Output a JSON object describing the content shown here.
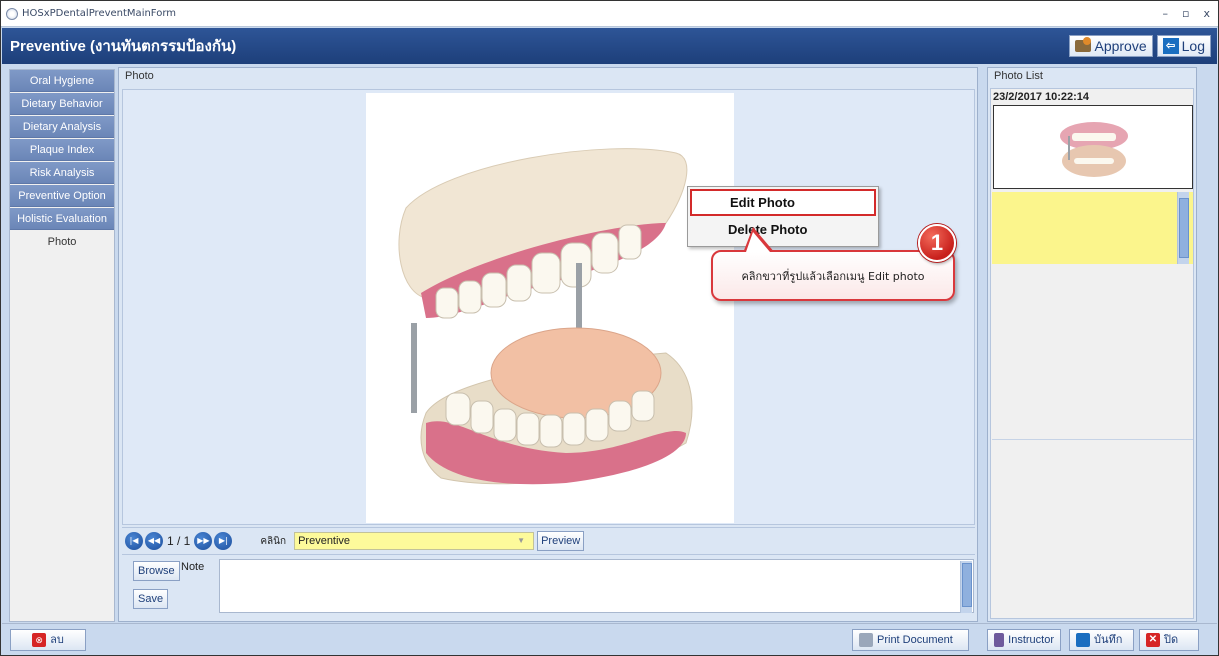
{
  "window": {
    "title": "HOSxPDentalPreventMainForm",
    "controls": [
      "–",
      "▫",
      "x"
    ]
  },
  "header": {
    "title": "Preventive (งานทันตกรรมป้องกัน)",
    "approve_label": "Approve",
    "log_label": "Log"
  },
  "sidebar": {
    "items": [
      {
        "label": "Oral Hygiene"
      },
      {
        "label": "Dietary Behavior"
      },
      {
        "label": "Dietary Analysis"
      },
      {
        "label": "Plaque Index"
      },
      {
        "label": "Risk Analysis"
      },
      {
        "label": "Preventive Option"
      },
      {
        "label": "Holistic Evaluation"
      },
      {
        "label": "Photo"
      }
    ],
    "active": "Photo"
  },
  "photo_panel": {
    "caption": "Photo",
    "context_menu": {
      "items": [
        "Edit Photo",
        "Delete Photo"
      ]
    },
    "callout": {
      "step": "1",
      "text": "คลิกขวาที่รูปแล้วเลือกเมนู Edit photo"
    },
    "nav": {
      "pager": "1 / 1",
      "clinic_label": "คลินิก",
      "clinic_value": "Preventive",
      "preview_label": "Preview"
    },
    "note": {
      "browse_label": "Browse",
      "save_label": "Save",
      "note_label": "Note",
      "note_value": ""
    }
  },
  "photo_list": {
    "caption": "Photo List",
    "items": [
      {
        "datetime": "23/2/2017 10:22:14"
      }
    ]
  },
  "bottom": {
    "delete_label": "ลบ",
    "print_label": "Print Document",
    "instructor_label": "Instructor",
    "save_label": "บันทึก",
    "close_label": "ปิด"
  }
}
